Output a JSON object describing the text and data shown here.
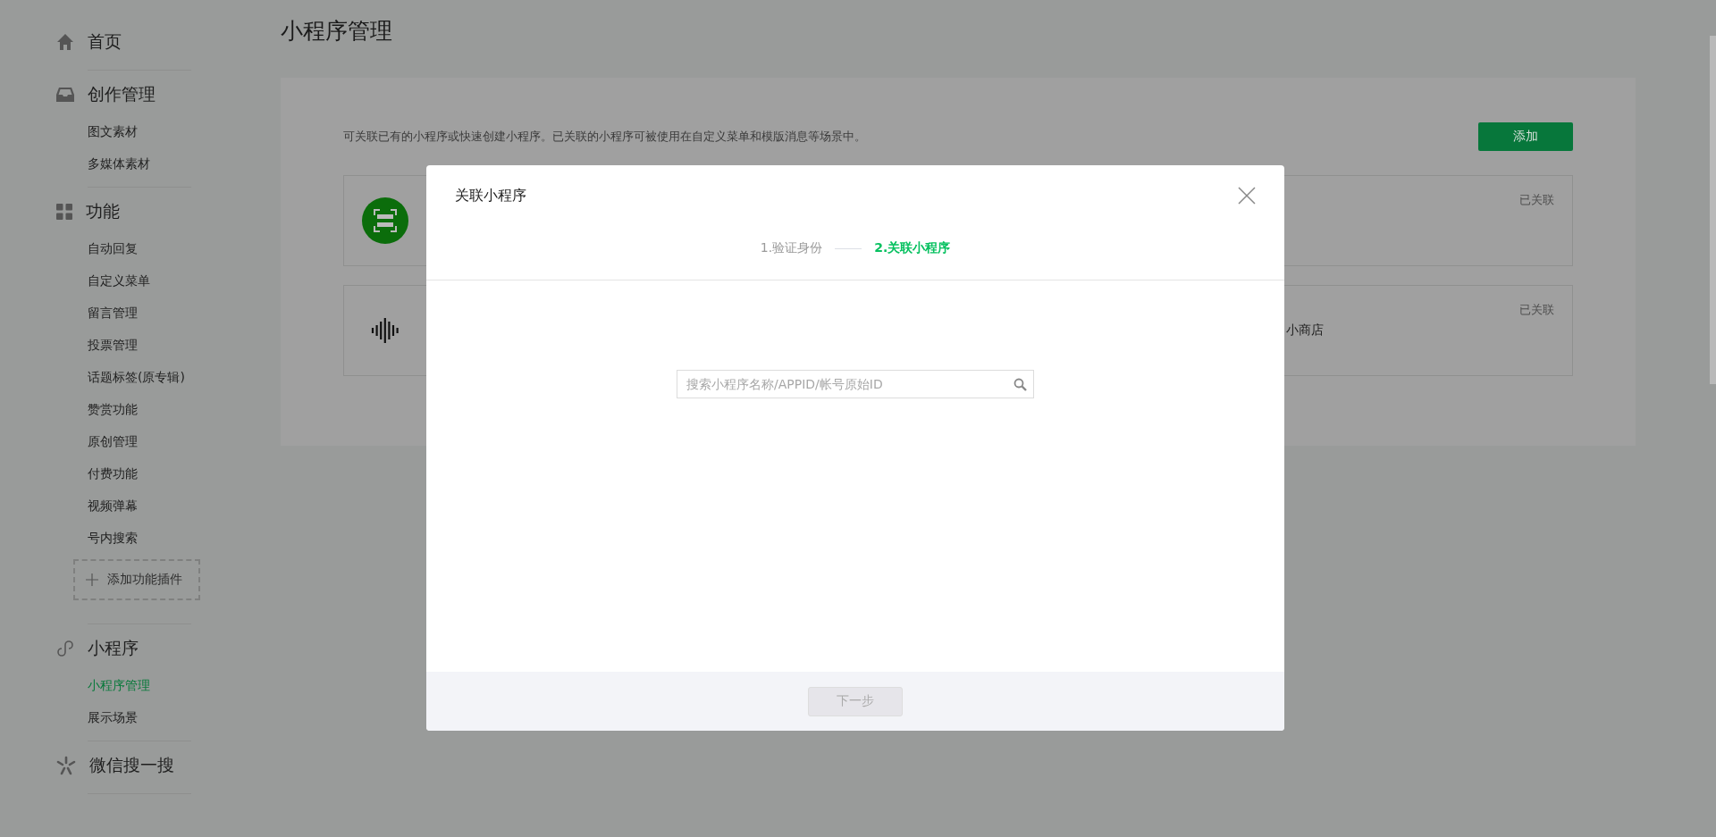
{
  "sidebar": {
    "sections": [
      {
        "title": "首页"
      },
      {
        "title": "创作管理",
        "items": [
          {
            "label": "图文素材",
            "selected": false
          },
          {
            "label": "多媒体素材",
            "selected": false
          }
        ]
      },
      {
        "title": "功能",
        "items": [
          {
            "label": "自动回复",
            "selected": false
          },
          {
            "label": "自定义菜单",
            "selected": false
          },
          {
            "label": "留言管理",
            "selected": false
          },
          {
            "label": "投票管理",
            "selected": false
          },
          {
            "label": "话题标签(原专辑)",
            "selected": false
          },
          {
            "label": "赞赏功能",
            "selected": false
          },
          {
            "label": "原创管理",
            "selected": false
          },
          {
            "label": "付费功能",
            "selected": false
          },
          {
            "label": "视频弹幕",
            "selected": false
          },
          {
            "label": "号内搜索",
            "selected": false
          }
        ],
        "add_plugin": "添加功能插件"
      },
      {
        "title": "小程序",
        "items": [
          {
            "label": "小程序管理",
            "selected": true
          },
          {
            "label": "展示场景",
            "selected": false
          }
        ]
      },
      {
        "title": "微信搜一搜"
      }
    ]
  },
  "page": {
    "title": "小程序管理",
    "description": "可关联已有的小程序或快速创建小程序。已关联的小程序可被使用在自定义菜单和模版消息等场景中。",
    "add_button": "添加",
    "cards": [
      {
        "status": "已关联"
      },
      {
        "text_end": "小商店",
        "status": "已关联"
      }
    ]
  },
  "dialog": {
    "title": "关联小程序",
    "steps": [
      {
        "label": "1.验证身份",
        "selected": false
      },
      {
        "label": "2.关联小程序",
        "selected": true
      }
    ],
    "search": {
      "placeholder": "搜索小程序名称/APPID/帐号原始ID"
    },
    "next_button": {
      "label": "下一步",
      "disabled": true
    }
  }
}
